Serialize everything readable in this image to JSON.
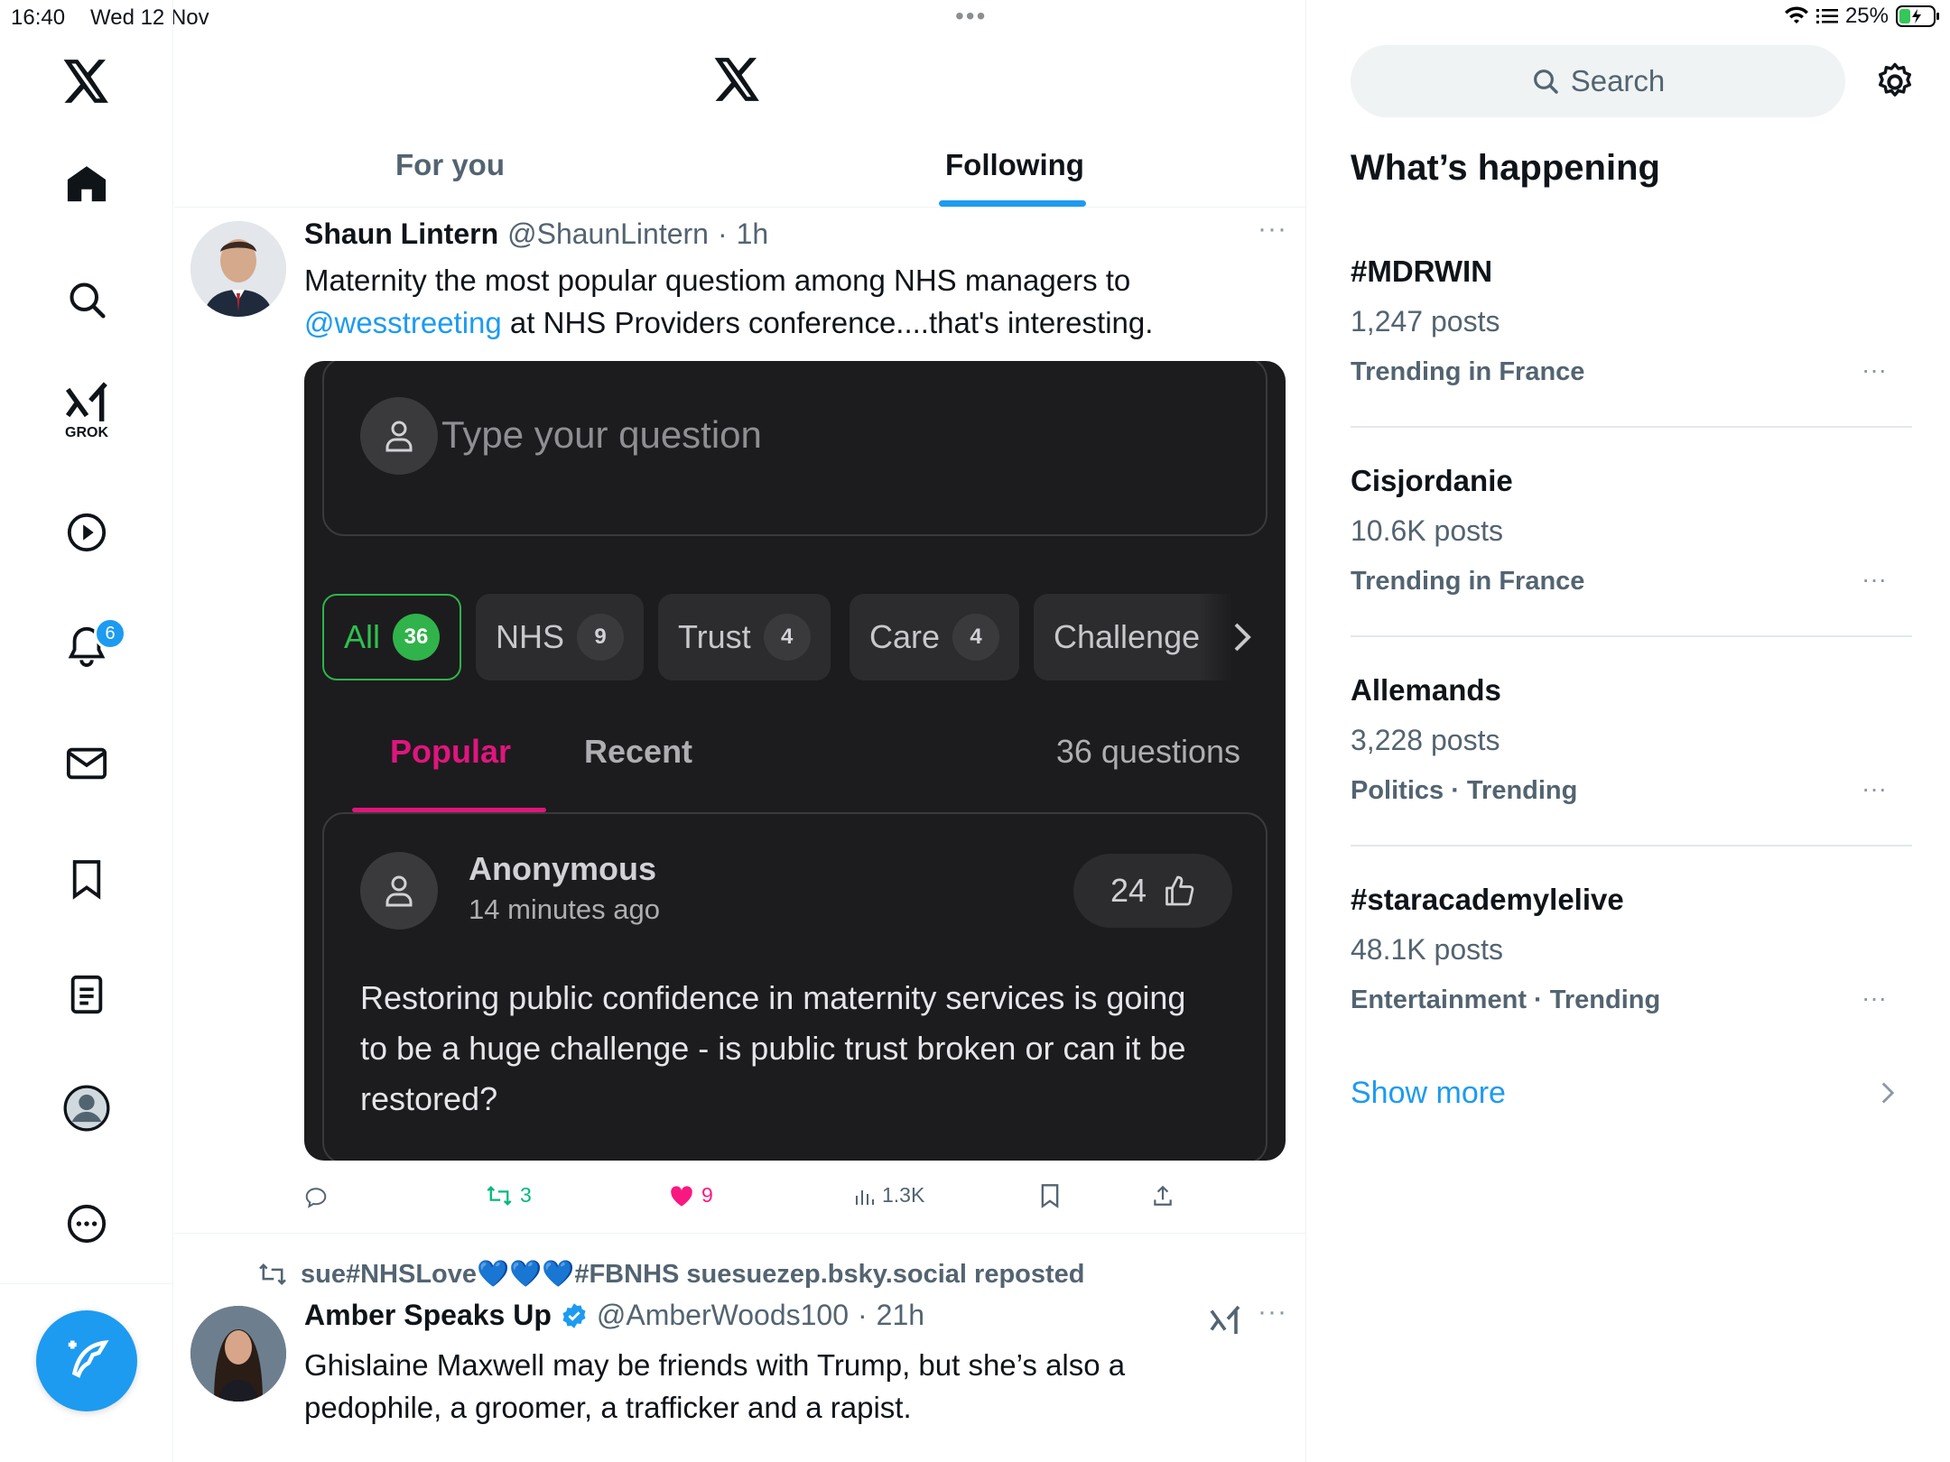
{
  "status_bar": {
    "time": "16:40",
    "date": "Wed 12 Nov",
    "battery": "25%"
  },
  "nav": {
    "notifications_badge": "6",
    "grok_label": "GROK"
  },
  "header": {
    "tabs": [
      "For you",
      "Following"
    ],
    "active_tab": "Following"
  },
  "tweet1": {
    "name": "Shaun Lintern",
    "handle": "@ShaunLintern",
    "time": "1h",
    "text_line1": "Maternity the most popular questiom among NHS managers to",
    "mention": "@wesstreeting",
    "text_line2_rest": " at NHS Providers conference....that's interesting.",
    "card": {
      "input_placeholder": "Type your question",
      "chips": [
        {
          "label": "All",
          "count": "36"
        },
        {
          "label": "NHS",
          "count": "9"
        },
        {
          "label": "Trust",
          "count": "4"
        },
        {
          "label": "Care",
          "count": "4"
        },
        {
          "label": "Challenge",
          "count": ""
        }
      ],
      "tabs": [
        "Popular",
        "Recent"
      ],
      "question_count": "36 questions",
      "question": {
        "author": "Anonymous",
        "time": "14 minutes ago",
        "likes": "24",
        "text_lines": [
          "Restoring public confidence in maternity services is going",
          "to be a huge challenge - is public trust broken or can it be",
          "restored?"
        ]
      }
    },
    "stats": {
      "retweets": "3",
      "likes": "9",
      "views": "1.3K"
    }
  },
  "tweet2": {
    "repost_line": "sue#NHSLove💙💙💙#FBNHS suesuezep.bsky.social reposted",
    "name": "Amber Speaks Up",
    "handle": "@AmberWoods100",
    "time": "21h",
    "text_line1": "Ghislaine Maxwell may be friends with Trump, but she’s also a",
    "text_line2": "pedophile, a groomer, a trafficker and a rapist."
  },
  "sidebar": {
    "search_placeholder": "Search",
    "heading": "What’s happening",
    "trends": [
      {
        "title": "#MDRWIN",
        "posts": "1,247 posts",
        "meta": "Trending in France"
      },
      {
        "title": "Cisjordanie",
        "posts": "10.6K posts",
        "meta": "Trending in France"
      },
      {
        "title": "Allemands",
        "posts": "3,228 posts",
        "meta": "Politics · Trending"
      },
      {
        "title": "#staracademylelive",
        "posts": "48.1K posts",
        "meta": "Entertainment · Trending"
      }
    ],
    "show_more": "Show more"
  },
  "colors": {
    "accent": "#1d9bf0",
    "pink": "#e0157d",
    "green": "#00ba7c",
    "chip_green": "#30b34a"
  }
}
